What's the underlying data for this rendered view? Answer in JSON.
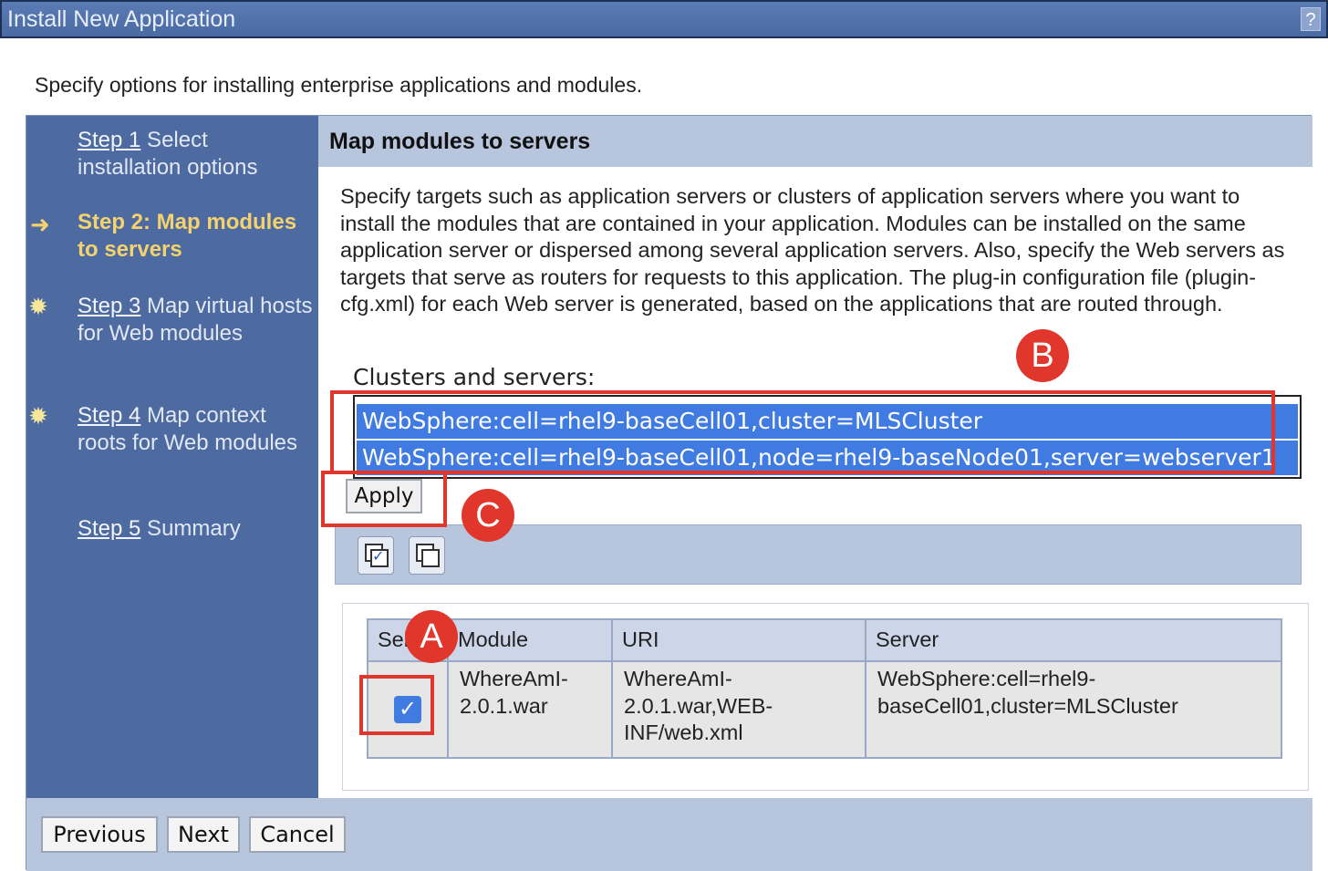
{
  "window": {
    "title": "Install New Application",
    "help_label": "?"
  },
  "intro": "Specify options for installing enterprise applications and modules.",
  "steps": [
    {
      "link": "Step 1",
      "text": " Select installation options",
      "marker": ""
    },
    {
      "link": "",
      "text": "Step 2: Map modules to servers",
      "marker": "arrow-icon"
    },
    {
      "link": "Step 3",
      "text": " Map virtual hosts for Web modules",
      "marker": "star-icon"
    },
    {
      "link": "Step 4",
      "text": " Map context roots for Web modules",
      "marker": "star-icon"
    },
    {
      "link": "Step 5",
      "text": " Summary",
      "marker": ""
    }
  ],
  "panel": {
    "title": "Map modules to servers",
    "description": "Specify targets such as application servers or clusters of application servers where you want to install the modules that are contained in your application. Modules can be installed on the same application server or dispersed among several application servers. Also, specify the Web servers as targets that serve as routers for requests to this application. The plug-in configuration file (plugin-cfg.xml) for each Web server is generated, based on the applications that are routed through.",
    "clusters_label": "Clusters and servers:",
    "clusters_options": [
      "WebSphere:cell=rhel9-baseCell01,cluster=MLSCluster",
      "WebSphere:cell=rhel9-baseCell01,node=rhel9-baseNode01,server=webserver1"
    ],
    "apply_label": "Apply",
    "toolbar_icons": [
      "select-all-icon",
      "deselect-all-icon"
    ]
  },
  "table": {
    "columns": [
      "Select",
      "Module",
      "URI",
      "Server"
    ],
    "rows": [
      {
        "selected": true,
        "module": "WhereAmI-2.0.1.war",
        "uri": "WhereAmI-2.0.1.war,WEB-INF/web.xml",
        "server": "WebSphere:cell=rhel9-baseCell01,cluster=MLSCluster"
      }
    ]
  },
  "footer": {
    "previous": "Previous",
    "next": "Next",
    "cancel": "Cancel"
  },
  "callouts": [
    "A",
    "B",
    "C"
  ],
  "colors": {
    "sidebar": "#4d6aa1",
    "header": "#b8c6dd",
    "selection": "#3f7be0",
    "callout": "#e0362c",
    "current_step": "#f4d36e"
  }
}
